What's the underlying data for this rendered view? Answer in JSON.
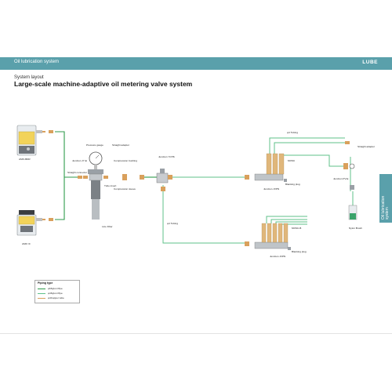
{
  "header": {
    "title": "Oil lubrication system",
    "logo": "LUBE"
  },
  "page": {
    "subtitle": "System layout",
    "title": "Large-scale machine-adaptive oil metering valve system"
  },
  "side_tab": {
    "line1": "Oil lubrication",
    "line2": "system"
  },
  "labels": {
    "ami_bdr": "AMO-BDR",
    "ami_iii": "AMO III",
    "pressure_gauge": "Pressure gauge",
    "straight_adaptor_top": "Straight adaptor",
    "junction_jy": "Junction JY-E",
    "straight_connector": "Straight connector",
    "compression_bushing": "Compression bushing",
    "tube_insert": "Tube insert",
    "compression_sleeve": "Compression sleeve",
    "line_filter": "Line Filter",
    "junction_ych": "Junction YCH6",
    "phi4_tubing_top": "φ4 Tubing",
    "phi4_tubing_mid": "φ4 Tubing",
    "straight_adaptor_right": "Straight adaptor",
    "mosc": "MOSC",
    "junction_jvpn_top": "Junction JVPN",
    "blanking_plug_top": "Blanking plug",
    "junction_pvc": "Junction PV-E",
    "nylon_brush": "Nylon Brush",
    "mosc_b": "MOSC-B",
    "junction_jvpn_bottom": "Junction JVPN",
    "blanking_plug_bottom": "Blanking plug"
  },
  "legend": {
    "title": "Piping type",
    "items": [
      {
        "label": "φ6Nylon Pipe",
        "color": "#2f9a4b"
      },
      {
        "label": "φ4Nylon Pipe",
        "color": "#5fc28a"
      },
      {
        "label": "φ4Copper tube",
        "color": "#d9a05c"
      }
    ]
  }
}
